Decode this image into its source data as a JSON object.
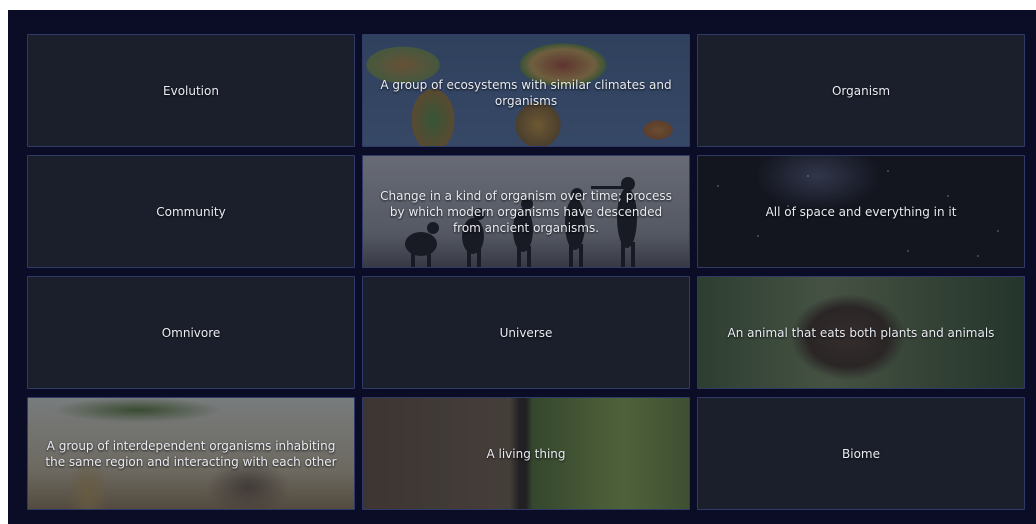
{
  "cards": [
    {
      "label": "Evolution",
      "image": "none"
    },
    {
      "label": "A group of ecosystems with similar climates and organisms",
      "image": "world-map"
    },
    {
      "label": "Organism",
      "image": "none"
    },
    {
      "label": "Community",
      "image": "none"
    },
    {
      "label": "Change in a kind of organism over time; process by which modern organisms have descended from ancient organisms.",
      "image": "evolution-silhouettes"
    },
    {
      "label": "All of space and everything in it",
      "image": "starfield"
    },
    {
      "label": "Omnivore",
      "image": "none"
    },
    {
      "label": "Universe",
      "image": "none"
    },
    {
      "label": "An animal that eats both plants and animals",
      "image": "bear-in-forest"
    },
    {
      "label": "A group of interdependent organisms inhabiting the same region and interacting with each other",
      "image": "savanna-animals"
    },
    {
      "label": "A living thing",
      "image": "animal-and-plants"
    },
    {
      "label": "Biome",
      "image": "none"
    }
  ],
  "colors": {
    "page": "#ffffff",
    "board": "#0b0c26",
    "card": "#1b1f2b",
    "card_border": "#2f3a66",
    "text": "#e9ebf2"
  }
}
